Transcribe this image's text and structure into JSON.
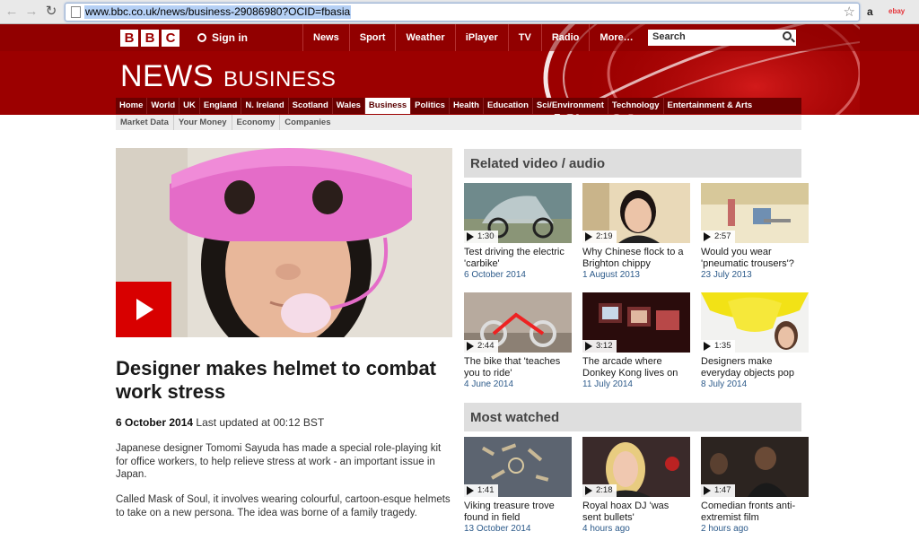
{
  "browser": {
    "url": "www.bbc.co.uk/news/business-29086980?OCID=fbasia",
    "extensions": [
      "a",
      "ebay"
    ]
  },
  "masthead": {
    "logo_letters": [
      "B",
      "B",
      "C"
    ],
    "sign_in": "Sign in",
    "top_nav": [
      "News",
      "Sport",
      "Weather",
      "iPlayer",
      "TV",
      "Radio",
      "More…"
    ],
    "search_placeholder": "Search",
    "title": "NEWS",
    "section": "BUSINESS"
  },
  "section_nav": [
    "Home",
    "World",
    "UK",
    "England",
    "N. Ireland",
    "Scotland",
    "Wales",
    "Business",
    "Politics",
    "Health",
    "Education",
    "Sci/Environment",
    "Technology",
    "Entertainment & Arts"
  ],
  "section_nav_active": "Business",
  "sub_nav": [
    "Market Data",
    "Your Money",
    "Economy",
    "Companies"
  ],
  "article": {
    "headline": "Designer makes helmet to combat work stress",
    "date": "6 October 2014",
    "updated": "Last updated at 00:12 BST",
    "paragraphs": [
      "Japanese designer Tomomi Sayuda has made a special role-playing kit for office workers, to help relieve stress at work - an important issue in Japan.",
      "Called Mask of Soul, it involves wearing colourful, cartoon-esque helmets to take on a new persona. The idea was borne of a family tragedy."
    ]
  },
  "related": {
    "heading": "Related video / audio",
    "items": [
      {
        "duration": "1:30",
        "title": "Test driving the electric 'carbike'",
        "date": "6 October 2014"
      },
      {
        "duration": "2:19",
        "title": "Why Chinese flock to a Brighton chippy",
        "date": "1 August 2013"
      },
      {
        "duration": "2:57",
        "title": "Would you wear 'pneumatic trousers'?",
        "date": "23 July 2013"
      },
      {
        "duration": "2:44",
        "title": "The bike that 'teaches you to ride'",
        "date": "4 June 2014"
      },
      {
        "duration": "3:12",
        "title": "The arcade where Donkey Kong lives on",
        "date": "11 July 2014"
      },
      {
        "duration": "1:35",
        "title": "Designers make everyday objects pop",
        "date": "8 July 2014"
      }
    ]
  },
  "most_watched": {
    "heading": "Most watched",
    "items": [
      {
        "duration": "1:41",
        "title": "Viking treasure trove found in field",
        "date": "13 October 2014"
      },
      {
        "duration": "2:18",
        "title": "Royal hoax DJ 'was sent bullets'",
        "date": "4 hours ago"
      },
      {
        "duration": "1:47",
        "title": "Comedian fronts anti-extremist film",
        "date": "2 hours ago"
      }
    ]
  },
  "colors": {
    "bbc_red": "#9c0000",
    "link_blue": "#2c5a8a",
    "play_red": "#d80000"
  }
}
